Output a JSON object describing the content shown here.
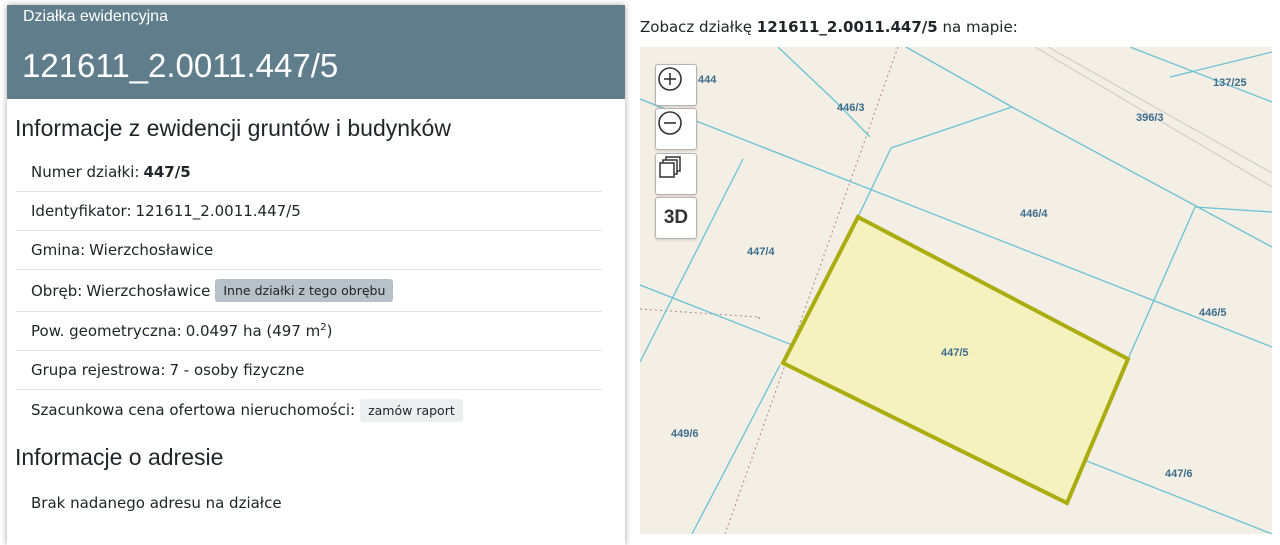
{
  "card": {
    "subtitle": "Działka ewidencyjna",
    "title": "121611_2.0011.447/5",
    "section1_title": "Informacje z ewidencji gruntów i budynków",
    "rows": {
      "numer_label": "Numer działki:",
      "numer_value": "447/5",
      "identyfikator_label": "Identyfikator:",
      "identyfikator_value": "121611_2.0011.447/5",
      "gmina_label": "Gmina:",
      "gmina_value": "Wierzchosławice",
      "obreb_label": "Obręb:",
      "obreb_value": "Wierzchosławice",
      "obreb_button": "Inne działki z tego obrębu",
      "pow_label": "Pow. geometryczna:",
      "pow_value": "0.0497 ha (497 m",
      "pow_sup": "2",
      "pow_close": ")",
      "grupa_label": "Grupa rejestrowa:",
      "grupa_value": "7 - osoby fizyczne",
      "cena_label": "Szacunkowa cena ofertowa nieruchomości:",
      "cena_button": "zamów raport"
    },
    "section2_title": "Informacje o adresie",
    "address_text": "Brak nadanego adresu na działce"
  },
  "map": {
    "caption_prefix": "Zobacz działkę",
    "caption_id": "121611_2.0011.447/5",
    "caption_suffix": "na mapie:",
    "controls": {
      "zoom_in": "zoom-in-icon",
      "zoom_out": "zoom-out-icon",
      "layers": "layers-icon",
      "label_3d": "3D"
    },
    "parcels": {
      "p444": "444",
      "p446_3": "446/3",
      "p396_3": "396/3",
      "p137_25": "137/25",
      "p446_4": "446/4",
      "p447_4": "447/4",
      "p446_5": "446/5",
      "p447_5": "447/5",
      "p449_6": "449/6",
      "p447_6": "447/6"
    },
    "colors": {
      "background": "#f3efe5",
      "parcel_line": "#6cc1d4",
      "selected_fill": "#f5f2c0",
      "selected_stroke": "#aaac10",
      "label": "#3d6e8c"
    }
  }
}
